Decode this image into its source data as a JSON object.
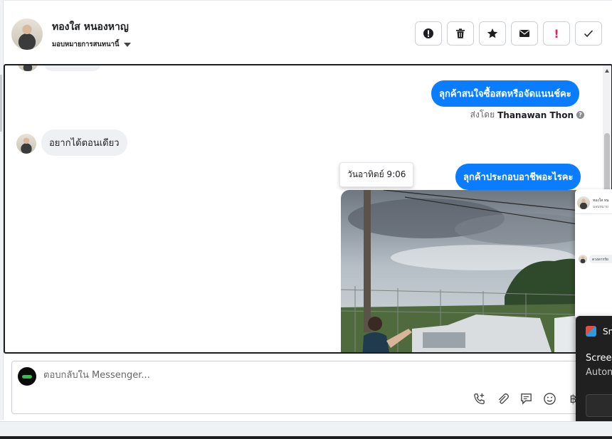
{
  "header": {
    "contact_name": "ทองใส หนองหาญ",
    "assign_label": "มอบหมายการสนทนานี้",
    "actions": [
      {
        "name": "spam-button",
        "icon": "exclamation-circle-icon"
      },
      {
        "name": "delete-button",
        "icon": "trash-icon"
      },
      {
        "name": "star-button",
        "icon": "star-icon"
      },
      {
        "name": "mark-unread-button",
        "icon": "envelope-icon"
      },
      {
        "name": "follow-up-button",
        "icon": "exclamation-icon",
        "label": "!"
      },
      {
        "name": "mark-done-button",
        "icon": "check-icon"
      }
    ]
  },
  "messages": {
    "outgoing_1": "ลุกค้าสนใจซื้อสดหรือจัดแนนช์คะ",
    "sent_by_prefix": "ส่งโดย",
    "sent_by_name": "Thanawan Thon",
    "incoming_1": "อยากได้ตอนเดียว",
    "timestamp_tooltip": "วันอาทิตย์ 9:06",
    "outgoing_2": "ลุกค้าประกอบอาชีพอะไรคะ"
  },
  "reply": {
    "placeholder": "ตอบกลับใน Messenger..."
  },
  "toolbar_icons": [
    "call-add-icon",
    "paperclip-icon",
    "saved-reply-icon",
    "emoji-icon",
    "baht-icon"
  ],
  "toast": {
    "title": "Sn",
    "line1": "Screer",
    "line2": "Autom"
  },
  "colors": {
    "outgoing_bubble": "#0a7cff",
    "incoming_bubble": "#eef0f3",
    "accent_red": "#e0245e"
  },
  "baht_symbol": "฿"
}
